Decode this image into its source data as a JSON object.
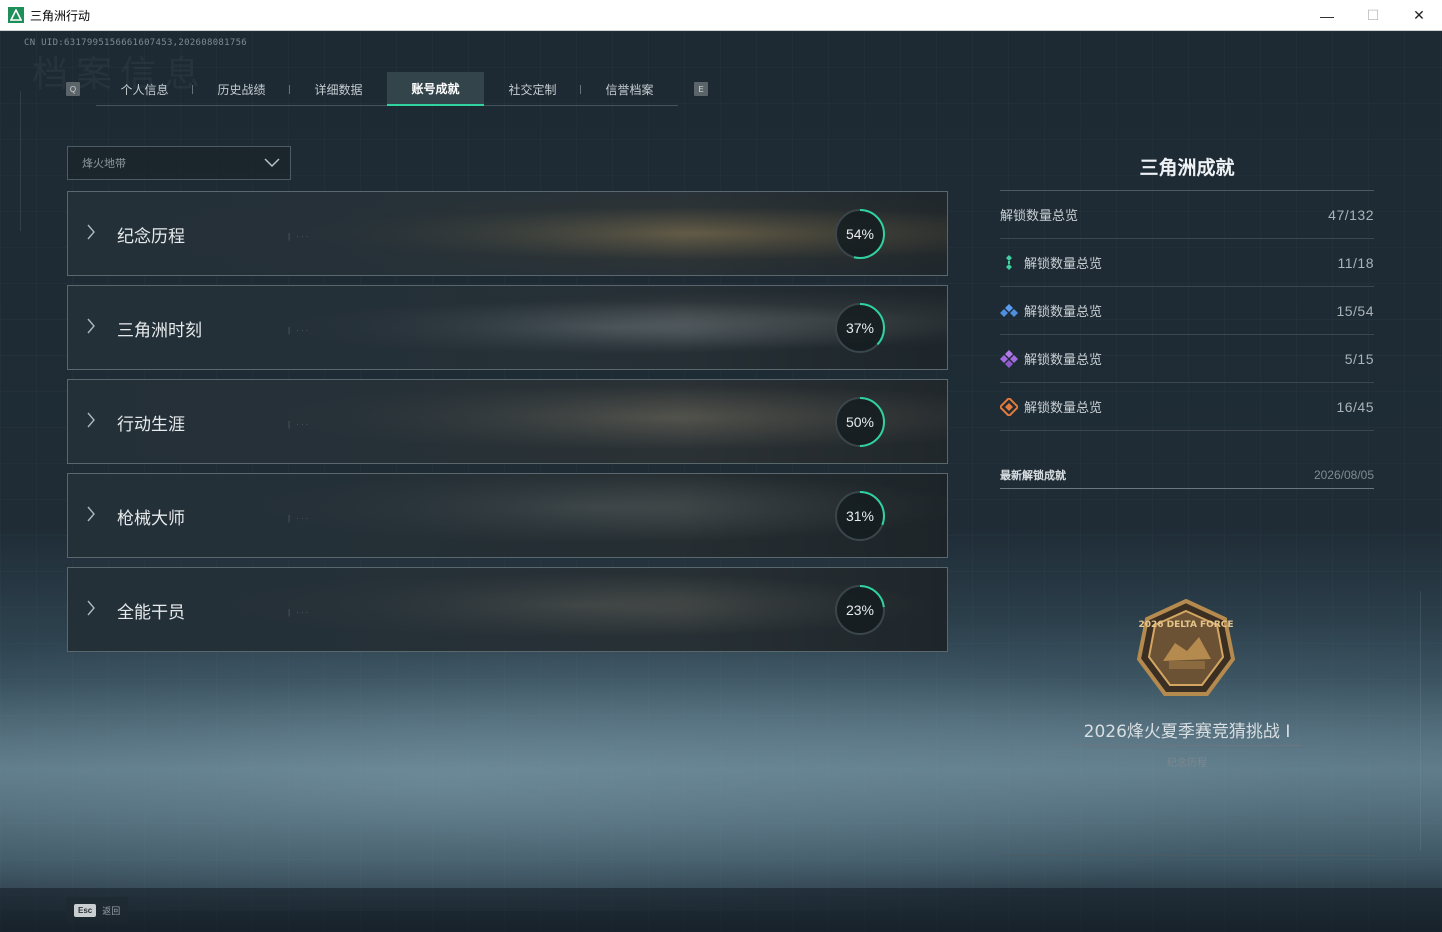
{
  "window": {
    "title": "三角洲行动",
    "minimize": "—",
    "maximize": "☐",
    "close": "✕"
  },
  "uid": "CN UID:6317995156661607453,202608081756",
  "ghost_title": "档案信息",
  "tabs": {
    "left_key": "Q",
    "right_key": "E",
    "items": [
      {
        "label": "个人信息",
        "active": false
      },
      {
        "label": "历史战绩",
        "active": false
      },
      {
        "label": "详细数据",
        "active": false
      },
      {
        "label": "账号成就",
        "active": true
      },
      {
        "label": "社交定制",
        "active": false
      },
      {
        "label": "信誉档案",
        "active": false
      }
    ]
  },
  "mode_select": {
    "value": "烽火地带"
  },
  "categories": [
    {
      "name": "纪念历程",
      "progress": 54,
      "progress_label": "54%"
    },
    {
      "name": "三角洲时刻",
      "progress": 37,
      "progress_label": "37%"
    },
    {
      "name": "行动生涯",
      "progress": 50,
      "progress_label": "50%"
    },
    {
      "name": "枪械大师",
      "progress": 31,
      "progress_label": "31%"
    },
    {
      "name": "全能干员",
      "progress": 23,
      "progress_label": "23%"
    }
  ],
  "summary": {
    "title": "三角洲成就",
    "rows": [
      {
        "label": "解锁数量总览",
        "value": "47/132",
        "icon": "none"
      },
      {
        "label": "解锁数量总览",
        "value": "11/18",
        "icon": "green-tier-icon",
        "color": "#3fd1a0"
      },
      {
        "label": "解锁数量总览",
        "value": "15/54",
        "icon": "blue-tier-icon",
        "color": "#4f8fe0"
      },
      {
        "label": "解锁数量总览",
        "value": "5/15",
        "icon": "purple-tier-icon",
        "color": "#a36be0"
      },
      {
        "label": "解锁数量总览",
        "value": "16/45",
        "icon": "orange-tier-icon",
        "color": "#e57a3c"
      }
    ],
    "latest": {
      "header": "最新解锁成就",
      "date": "2026/08/05",
      "name": "2026烽火夏季赛竞猜挑战 I",
      "category": "纪念历程",
      "badge_text": "2026 DELTA FORCE"
    }
  },
  "footer": {
    "esc_key": "Esc",
    "esc_label": "返回"
  },
  "colors": {
    "accent": "#2fd3a0",
    "ring_track": "#3a464c"
  }
}
